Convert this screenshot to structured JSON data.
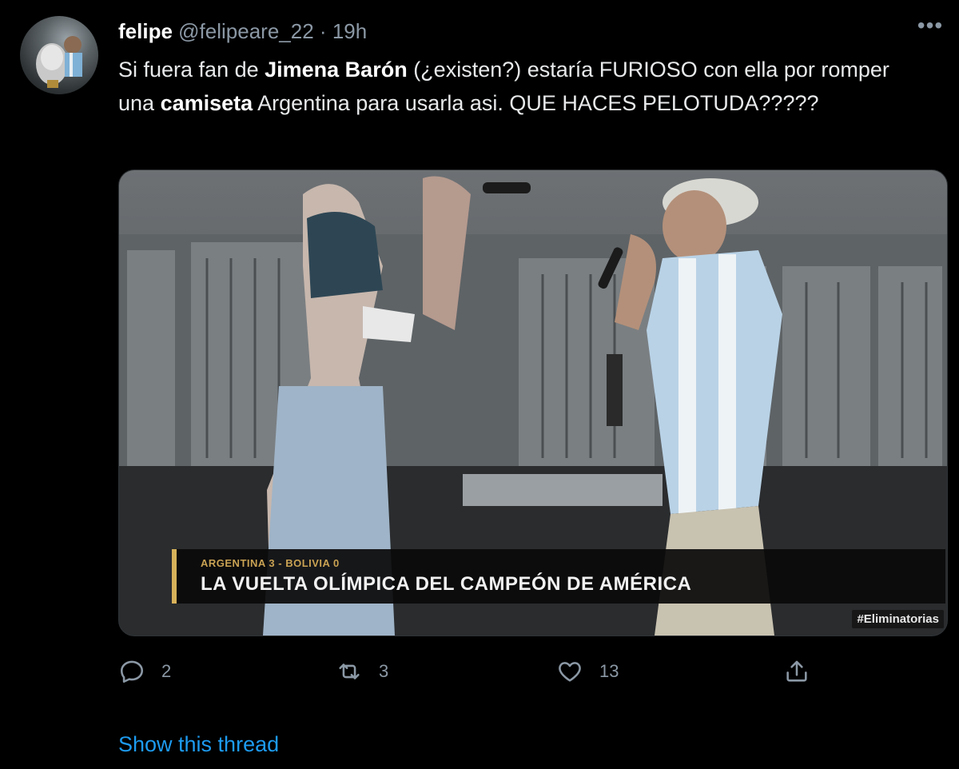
{
  "tweet": {
    "author": {
      "name": "felipe",
      "handle": "@felipeare_22",
      "separator": "·",
      "time": "19h",
      "avatar_icon": "avatar-trophy-photo"
    },
    "more_icon": "more-options-icon",
    "text_segments": {
      "s1": "Si fuera fan de ",
      "b1": "Jimena Barón",
      "s2": " (¿existen?) estaría FURIOSO con ella por romper una ",
      "b2": "camiseta",
      "s3": " Argentina para usarla asi. QUE HACES PELOTUDA?????"
    },
    "media": {
      "overlay_top": "ARGENTINA 3 - BOLIVIA 0",
      "overlay_main": "LA VUELTA OLÍMPICA DEL CAMPEÓN DE AMÉRICA",
      "hashtag": "#Eliminatorias",
      "accent_color": "#d8b25a"
    },
    "actions": {
      "reply": {
        "icon": "reply-icon",
        "count": "2"
      },
      "retweet": {
        "icon": "retweet-icon",
        "count": "3"
      },
      "like": {
        "icon": "heart-icon",
        "count": "13"
      },
      "share": {
        "icon": "share-icon"
      }
    },
    "show_thread": "Show this thread",
    "colors": {
      "background": "#000000",
      "secondary_text": "#8b98a5",
      "link": "#1d9bf0"
    }
  }
}
